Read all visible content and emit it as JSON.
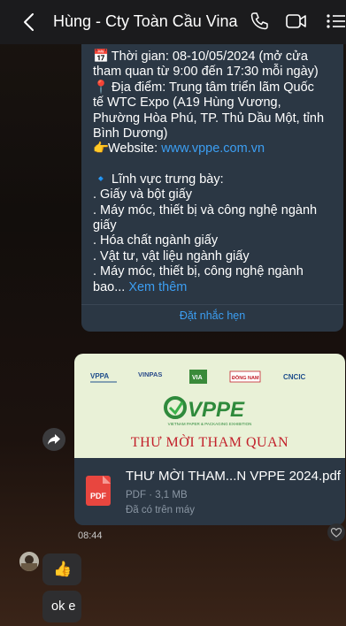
{
  "header": {
    "title": "Hùng - Cty Toàn Cầu Vina",
    "back_icon": "chevron-left-icon",
    "call_icon": "phone-icon",
    "video_icon": "video-icon",
    "menu_icon": "list-menu-icon"
  },
  "message": {
    "lines": [
      {
        "emoji": "📅",
        "text": " Thời gian: 08-10/05/2024 (mở cửa"
      },
      {
        "text": "tham quan từ 9:00 đến 17:30 mỗi ngày)"
      },
      {
        "emoji": "📍",
        "text": " Địa điểm: Trung tâm triển lãm Quốc"
      },
      {
        "text": "tế WTC Expo (A19 Hùng Vương,"
      },
      {
        "text": "Phường Hòa Phú, TP. Thủ Dầu Một, tỉnh"
      },
      {
        "text": "Bình Dương)"
      },
      {
        "emoji": "👉",
        "text": "Website: ",
        "link": "www.vppe.com.vn"
      },
      {
        "text": ""
      },
      {
        "emoji": "🔹",
        "text": " Lĩnh vực trưng bày:"
      },
      {
        "text": ". Giấy và bột giấy"
      },
      {
        "text": ". Máy móc, thiết bị và công nghệ ngành"
      },
      {
        "text": "giấy"
      },
      {
        "text": ". Hóa chất ngành giấy"
      },
      {
        "text": ". Vật tư, vật liệu ngành giấy"
      },
      {
        "text": ". Máy móc, thiết bị, công nghệ ngành"
      },
      {
        "text": "bao... ",
        "link": "Xem thêm"
      }
    ],
    "reminder_label": "Đặt nhắc hẹn"
  },
  "attachment": {
    "image": {
      "logos": [
        "VPPA",
        "VINPAS",
        "VIA",
        "ĐỒNG NAM",
        "CNCIC"
      ],
      "brand": "VPPE",
      "brand_sub": "VIETNAM PAPER & PACKAGING EXHIBITION",
      "heading": "THƯ MỜI THAM QUAN"
    },
    "file_type_label": "PDF",
    "file_name": "THƯ MỜI THAM...N VPPE 2024.pdf",
    "file_meta": "PDF · 3,1 MB",
    "file_status": "Đã có trên máy"
  },
  "timestamp": "08:44",
  "replies": {
    "like_emoji": "👍",
    "text": "ok e"
  },
  "colors": {
    "bubble_bg": "#2b3744",
    "link": "#3c9ef2",
    "pdf_red": "#e8463f",
    "invite_red": "#c2202a"
  }
}
